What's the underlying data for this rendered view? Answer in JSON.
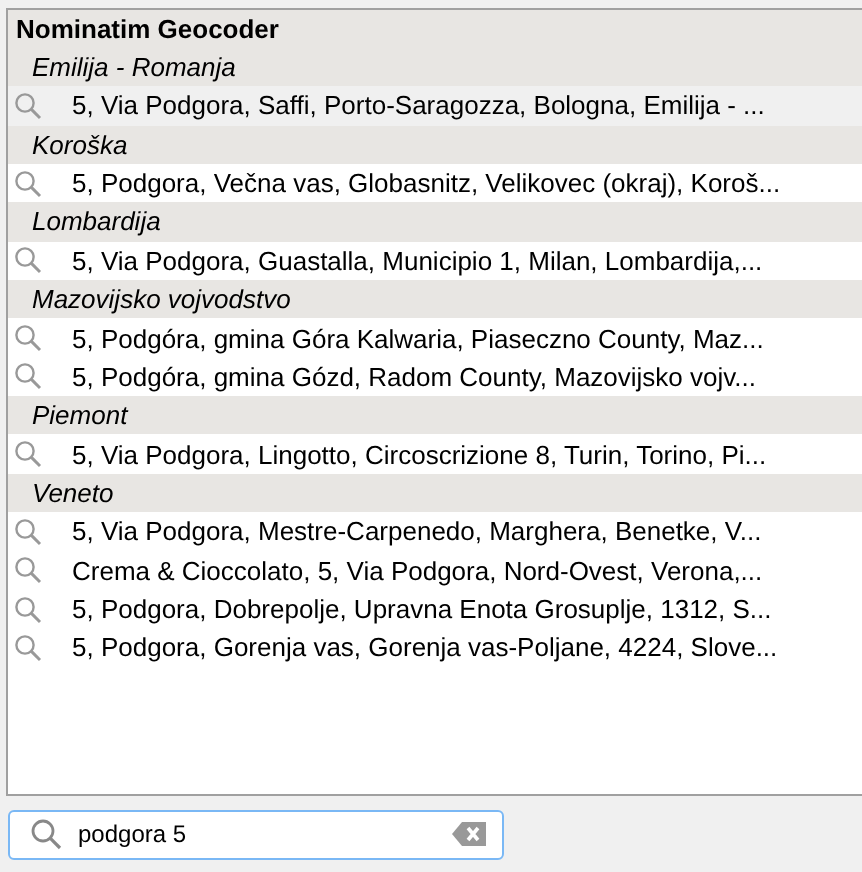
{
  "popup": {
    "title": "Nominatim Geocoder",
    "groups": [
      {
        "name": "Emilija - Romanja",
        "results": [
          {
            "text": "5, Via Podgora, Saffi, Porto-Saragozza, Bologna, Emilija - ...",
            "selected": true
          }
        ]
      },
      {
        "name": "Koroška",
        "results": [
          {
            "text": "5, Podgora, Večna vas, Globasnitz, Velikovec (okraj), Koroš...",
            "selected": false
          }
        ]
      },
      {
        "name": "Lombardija",
        "results": [
          {
            "text": "5, Via Podgora, Guastalla, Municipio 1, Milan, Lombardija,...",
            "selected": false
          }
        ]
      },
      {
        "name": "Mazovijsko vojvodstvo",
        "results": [
          {
            "text": "5, Podgóra, gmina Góra Kalwaria, Piaseczno County, Maz...",
            "selected": false
          },
          {
            "text": "5, Podgóra, gmina Gózd, Radom County, Mazovijsko vojv...",
            "selected": false
          }
        ]
      },
      {
        "name": "Piemont",
        "results": [
          {
            "text": "5, Via Podgora, Lingotto, Circoscrizione 8, Turin, Torino, Pi...",
            "selected": false
          }
        ]
      },
      {
        "name": "Veneto",
        "results": [
          {
            "text": "5, Via Podgora, Mestre-Carpenedo, Marghera, Benetke, V...",
            "selected": false
          },
          {
            "text": "Crema & Cioccolato, 5, Via Podgora, Nord-Ovest, Verona,...",
            "selected": false
          },
          {
            "text": "5, Podgora, Dobrepolje, Upravna Enota Grosuplje, 1312, S...",
            "selected": false
          },
          {
            "text": "5, Podgora, Gorenja vas, Gorenja vas-Poljane, 4224, Slove...",
            "selected": false
          }
        ]
      }
    ]
  },
  "search": {
    "value": "podgora 5"
  }
}
